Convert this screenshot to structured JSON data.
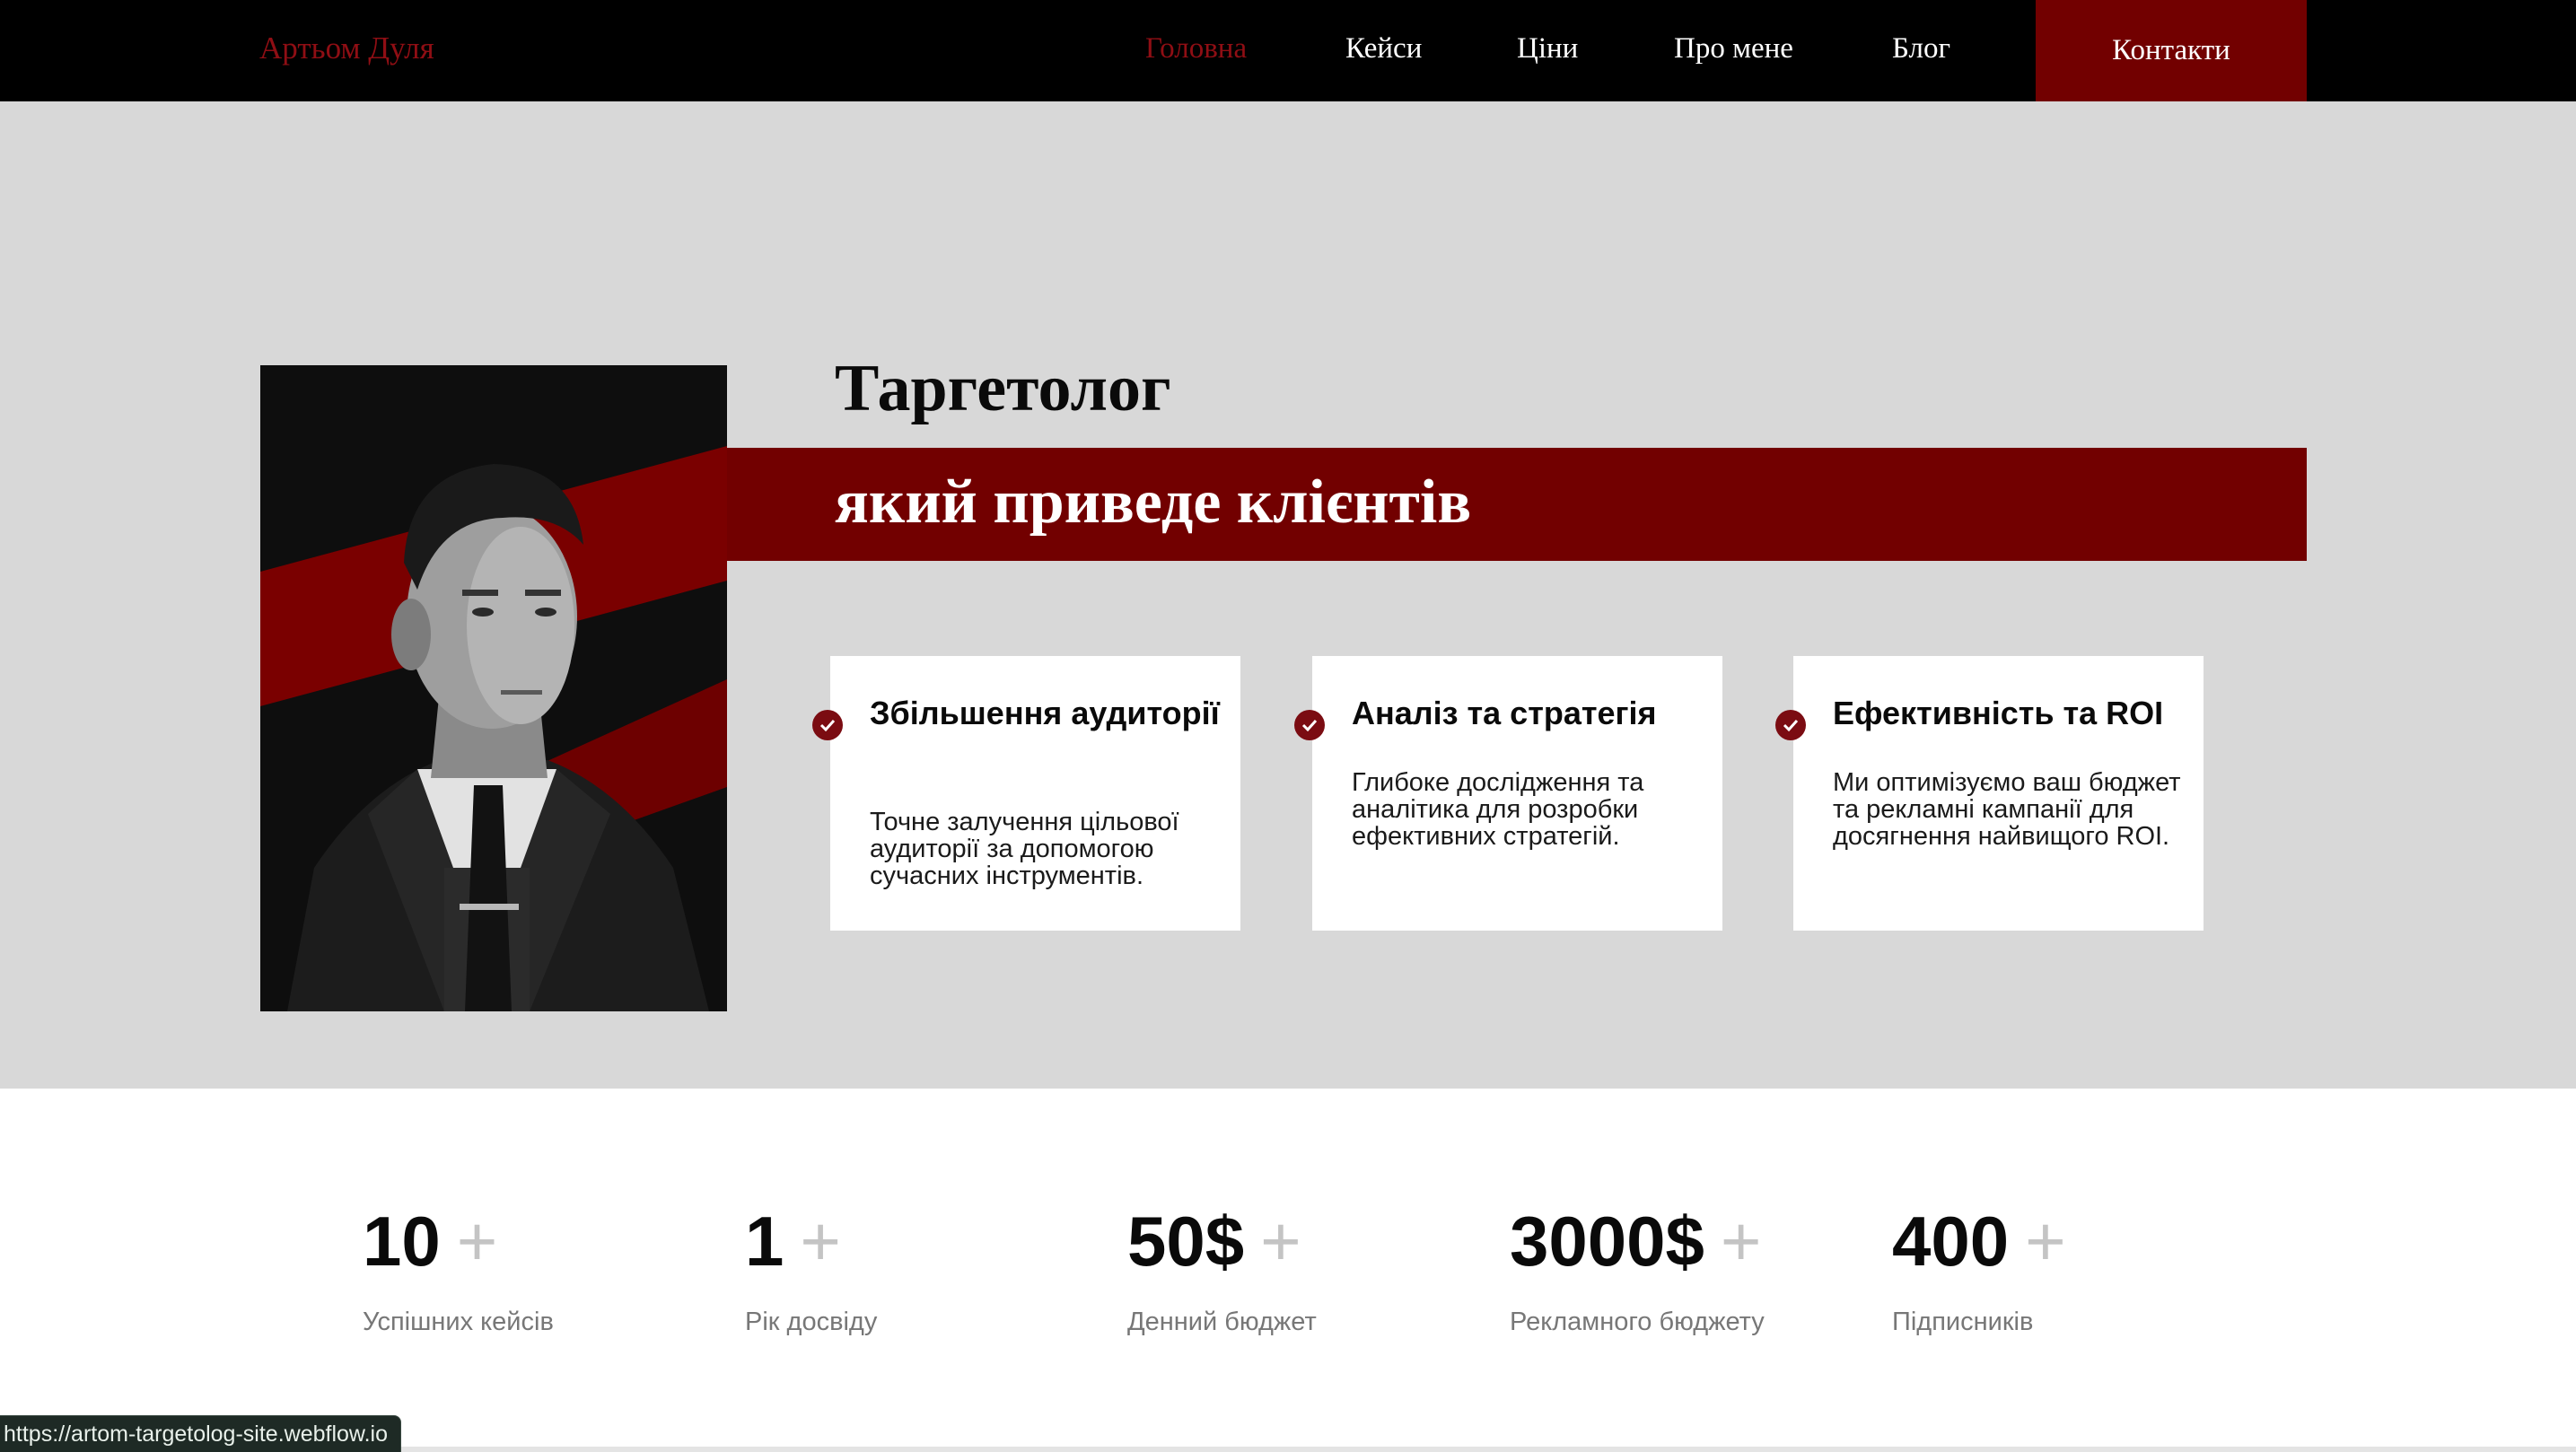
{
  "navbar": {
    "brand": "Артьом Дуля",
    "links": [
      {
        "label": "Головна",
        "active": true
      },
      {
        "label": "Кейси"
      },
      {
        "label": "Ціни"
      },
      {
        "label": "Про мене"
      },
      {
        "label": "Блог"
      }
    ],
    "contacts_label": "Контакти"
  },
  "hero": {
    "title": "Таргетолог",
    "subtitle": "який приведе клієнтів",
    "cards": [
      {
        "title": "Збільшення аудиторії",
        "text": "Точне залучення цільової аудиторії за допомогою сучасних інструментів.",
        "icon": "check-circle-icon"
      },
      {
        "title": "Аналіз та стратегія",
        "text": "Глибоке дослідження та аналітика для розробки ефективних стратегій.",
        "icon": "check-circle-icon"
      },
      {
        "title": "Ефективність та ROI",
        "text": "Ми оптимізуємо ваш бюджет та рекламні кампанії для досягнення найвищого ROI.",
        "icon": "check-circle-icon"
      }
    ]
  },
  "stats": [
    {
      "value": "10",
      "plus": "+",
      "label": "Успішних кейсів"
    },
    {
      "value": "1",
      "plus": "+",
      "label": "Рік досвіду"
    },
    {
      "value": "50$",
      "plus": "+",
      "label": "Денний бюджет"
    },
    {
      "value": "3000$",
      "plus": "+",
      "label": "Рекламного бюджету"
    },
    {
      "value": "400",
      "plus": "+",
      "label": "Підписників"
    }
  ],
  "status_bar": {
    "url": "https://artom-targetolog-site.webflow.io"
  },
  "colors": {
    "accent": "#720000",
    "brand_text": "#8f0e14",
    "hero_bg": "#d8d8d8",
    "nav_bg": "#000000"
  }
}
